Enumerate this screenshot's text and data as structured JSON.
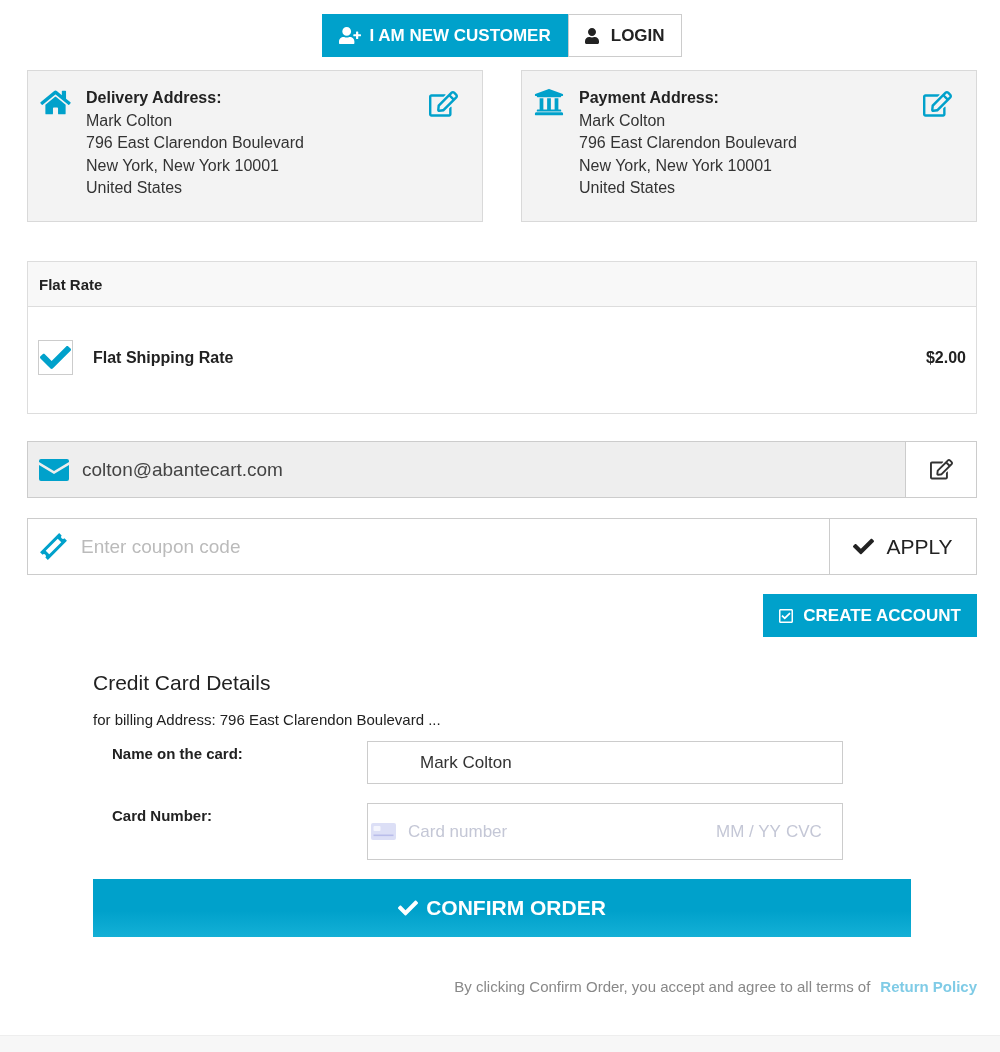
{
  "customer_tabs": [
    {
      "kind": "new",
      "label": "I AM NEW CUSTOMER",
      "selected": true
    },
    {
      "kind": "login",
      "label": "LOGIN",
      "selected": false
    }
  ],
  "addresses": [
    {
      "kind": "delivery",
      "title": "Delivery Address:",
      "lines": [
        "Mark Colton",
        "796 East Clarendon Boulevard",
        "New York, New York 10001",
        "United States"
      ]
    },
    {
      "kind": "payment",
      "title": "Payment Address:",
      "lines": [
        "Mark Colton",
        "796 East Clarendon Boulevard",
        "New York, New York 10001",
        "United States"
      ]
    }
  ],
  "shipping": {
    "title": "Flat Rate",
    "options": [
      {
        "label": "Flat Shipping Rate",
        "price": "$2.00",
        "checked": true
      }
    ]
  },
  "email": {
    "value": "colton@abantecart.com"
  },
  "coupon": {
    "placeholder": "Enter coupon code",
    "button": "APPLY"
  },
  "create_account_button": "CREATE ACCOUNT",
  "credit_card": {
    "title": "Credit Card Details",
    "billing_note": "for billing Address: 796 East Clarendon Boulevard ...",
    "fields": [
      {
        "kind": "text",
        "label": "Name on the card:",
        "value": "Mark Colton"
      },
      {
        "kind": "card",
        "label": "Card Number:",
        "placeholder": "Card number",
        "expiry_placeholder": "MM / YY",
        "cvc_placeholder": "CVC"
      }
    ]
  },
  "confirm_button": "CONFIRM ORDER",
  "terms": {
    "text": "By clicking Confirm Order, you accept and agree to all terms of",
    "link": "Return Policy"
  }
}
